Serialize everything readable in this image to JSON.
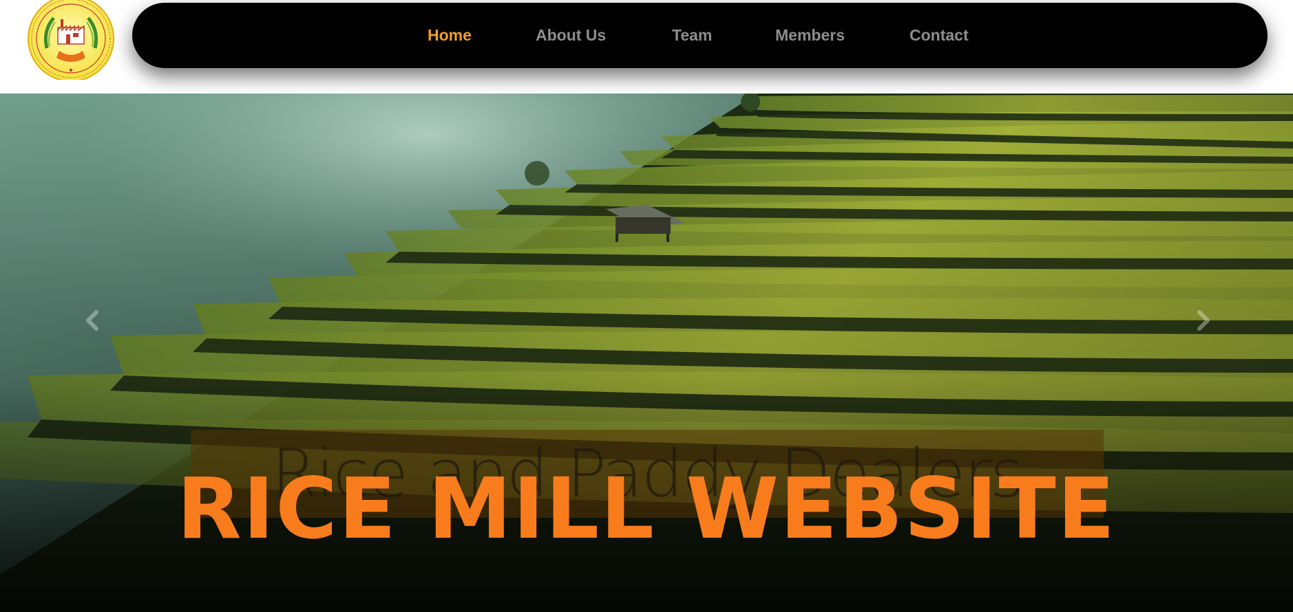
{
  "nav": {
    "items": [
      {
        "label": "Home",
        "active": true
      },
      {
        "label": "About Us",
        "active": false
      },
      {
        "label": "Team",
        "active": false
      },
      {
        "label": "Members",
        "active": false
      },
      {
        "label": "Contact",
        "active": false
      }
    ]
  },
  "hero": {
    "tagline": "Rice and Paddy Dealers",
    "title": "RICE MILL WEBSITE",
    "prev_icon": "chevron-left-icon",
    "next_icon": "chevron-right-icon"
  },
  "colors": {
    "nav_background": "#000000",
    "nav_text": "#8e8e8e",
    "nav_active": "#f4a020",
    "title": "#f97c1c",
    "logo_ring": "#f5e13a"
  }
}
